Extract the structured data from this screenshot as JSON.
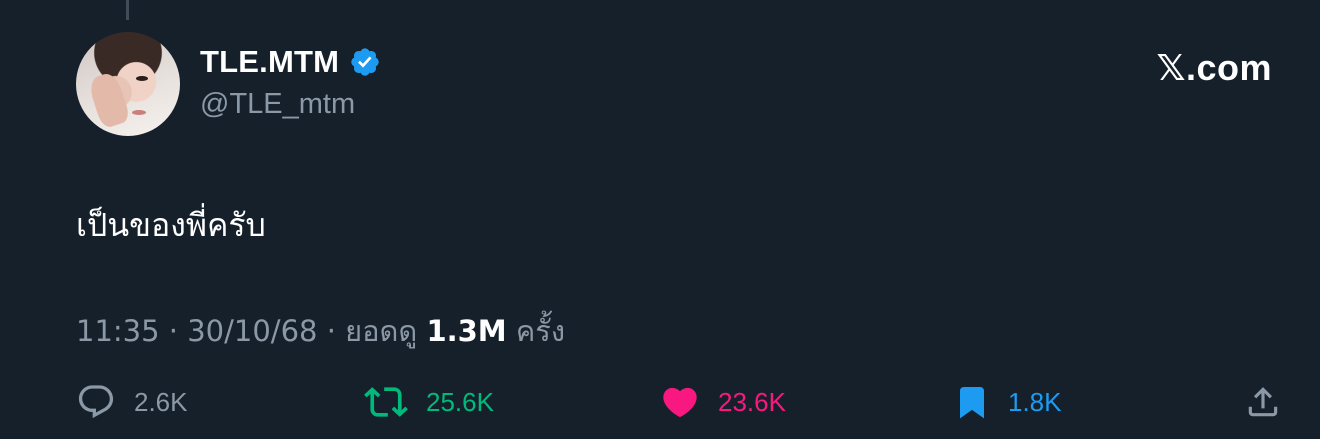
{
  "author": {
    "display_name": "TLE.MTM",
    "handle": "@TLE_mtm",
    "verified_icon": "verified-badge-icon",
    "verified_color": "#1d9bf0"
  },
  "brand": "𝕏.com",
  "tweet": {
    "text": "เป็นของพี่ครับ"
  },
  "meta": {
    "time": "11:35",
    "separator": " · ",
    "date": "30/10/68",
    "views_prefix": "ยอดดู",
    "views_count": "1.3M",
    "views_suffix": "ครั้ง"
  },
  "actions": {
    "reply": {
      "icon": "reply-icon",
      "count": "2.6K",
      "color": "#8b98a5"
    },
    "retweet": {
      "icon": "retweet-icon",
      "count": "25.6K",
      "color": "#00ba7c"
    },
    "like": {
      "icon": "heart-icon",
      "count": "23.6K",
      "color": "#f91880"
    },
    "bookmark": {
      "icon": "bookmark-icon",
      "count": "1.8K",
      "color": "#1d9bf0"
    },
    "share": {
      "icon": "share-icon"
    }
  },
  "theme": {
    "background": "#15202b",
    "text_primary": "#ffffff",
    "text_secondary": "#8b98a5"
  }
}
